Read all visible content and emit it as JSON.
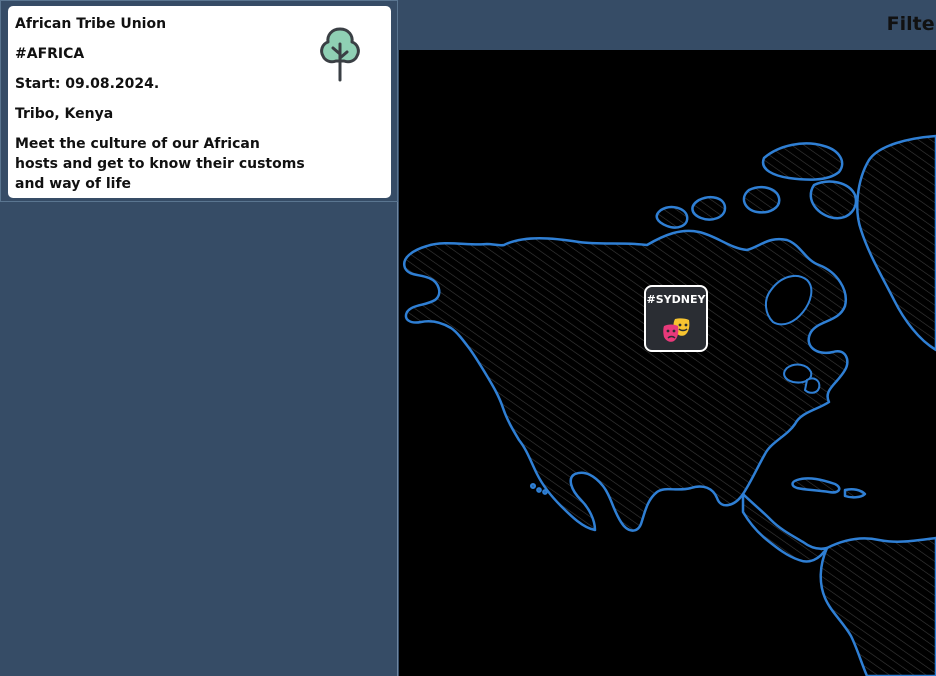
{
  "event_card": {
    "title": "African Tribe Union",
    "hashtag": "#AFRICA",
    "start": "Start: 09.08.2024.",
    "location": "Tribo, Kenya",
    "description": "Meet the culture of our African hosts and get to know their customs and way of life",
    "icon": "tree-icon"
  },
  "topbar": {
    "filter_label": "Filter"
  },
  "map": {
    "coastline_color": "#2f7fd4",
    "background_color": "#000000",
    "marker": {
      "tag": "#SYDNEY",
      "icon": "theater-masks-icon"
    }
  }
}
